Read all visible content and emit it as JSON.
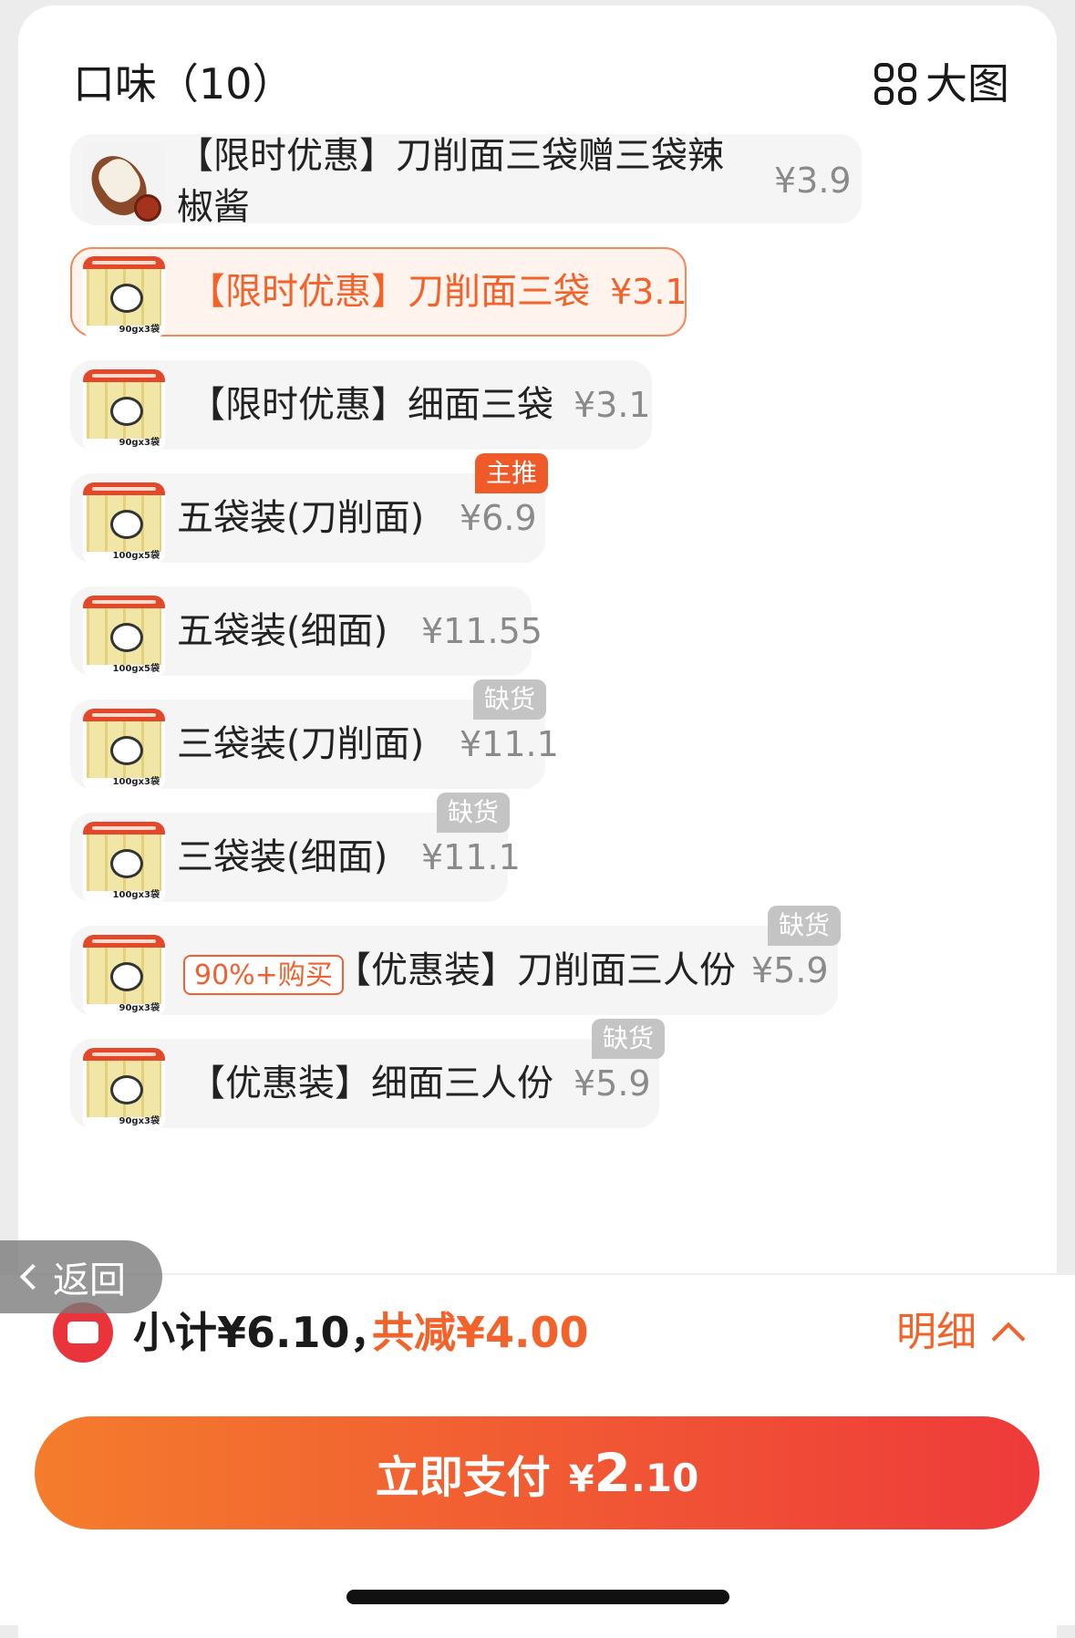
{
  "header": {
    "title": "口味（10）",
    "big_view_label": "大图"
  },
  "options": [
    {
      "name": "【限时优惠】刀削面三袋赠三袋辣椒酱",
      "price": "¥3.9"
    },
    {
      "name": "【限时优惠】刀削面三袋",
      "price": "¥3.1",
      "selected": true
    },
    {
      "name": "【限时优惠】细面三袋",
      "price": "¥3.1"
    },
    {
      "name": "五袋装(刀削面)",
      "price": "¥6.9",
      "tag": "主推"
    },
    {
      "name": "五袋装(细面)",
      "price": "¥11.55"
    },
    {
      "name": "三袋装(刀削面)",
      "price": "¥11.1",
      "tag": "缺货"
    },
    {
      "name": "三袋装(细面)",
      "price": "¥11.1",
      "tag": "缺货"
    },
    {
      "name": "【优惠装】刀削面三人份",
      "price": "¥5.9",
      "tag": "缺货",
      "promo": "90%+购买"
    },
    {
      "name": "【优惠装】细面三人份",
      "price": "¥5.9",
      "tag": "缺货"
    }
  ],
  "back_label": "返回",
  "footer": {
    "subtotal": "小计¥6.10，",
    "discount": "共减¥4.00",
    "detail_label": "明细",
    "pay_label": "立即支付",
    "pay_currency": "¥",
    "pay_int": "2",
    "pay_dec": ".10"
  },
  "colors": {
    "accent": "#f2622a",
    "pay_start": "#f47c2c",
    "pay_end": "#ee3a3a"
  }
}
